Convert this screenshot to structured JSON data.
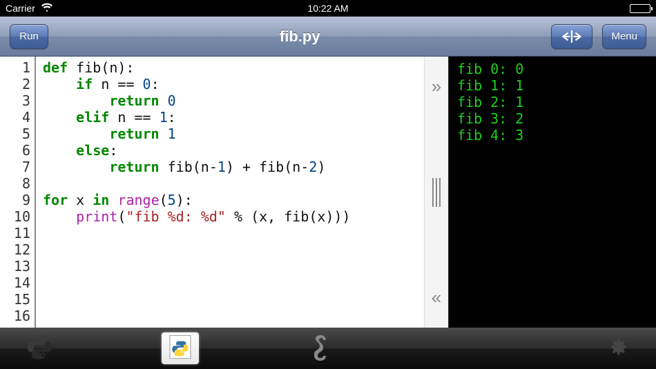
{
  "statusbar": {
    "carrier": "Carrier",
    "time": "10:22 AM"
  },
  "toolbar": {
    "run_label": "Run",
    "title": "fib.py",
    "menu_label": "Menu"
  },
  "code": {
    "line_count": 16,
    "lines": [
      [
        [
          "kw",
          "def"
        ],
        [
          "sp",
          " "
        ],
        [
          "id",
          "fib"
        ],
        [
          "op",
          "(n):"
        ]
      ],
      [
        [
          "ind",
          1
        ],
        [
          "kw",
          "if"
        ],
        [
          "sp",
          " "
        ],
        [
          "id",
          "n"
        ],
        [
          "sp",
          " "
        ],
        [
          "op",
          "=="
        ],
        [
          "sp",
          " "
        ],
        [
          "num",
          "0"
        ],
        [
          "op",
          ":"
        ]
      ],
      [
        [
          "ind",
          2
        ],
        [
          "kw",
          "return"
        ],
        [
          "sp",
          " "
        ],
        [
          "num",
          "0"
        ]
      ],
      [
        [
          "ind",
          1
        ],
        [
          "kw",
          "elif"
        ],
        [
          "sp",
          " "
        ],
        [
          "id",
          "n"
        ],
        [
          "sp",
          " "
        ],
        [
          "op",
          "=="
        ],
        [
          "sp",
          " "
        ],
        [
          "num",
          "1"
        ],
        [
          "op",
          ":"
        ]
      ],
      [
        [
          "ind",
          2
        ],
        [
          "kw",
          "return"
        ],
        [
          "sp",
          " "
        ],
        [
          "num",
          "1"
        ]
      ],
      [
        [
          "ind",
          1
        ],
        [
          "kw",
          "else"
        ],
        [
          "op",
          ":"
        ]
      ],
      [
        [
          "ind",
          2
        ],
        [
          "kw",
          "return"
        ],
        [
          "sp",
          " "
        ],
        [
          "id",
          "fib(n"
        ],
        [
          "op",
          "-"
        ],
        [
          "num",
          "1"
        ],
        [
          "id",
          ")"
        ],
        [
          "sp",
          " "
        ],
        [
          "op",
          "+"
        ],
        [
          "sp",
          " "
        ],
        [
          "id",
          "fib(n"
        ],
        [
          "op",
          "-"
        ],
        [
          "num",
          "2"
        ],
        [
          "id",
          ")"
        ]
      ],
      [],
      [
        [
          "kw",
          "for"
        ],
        [
          "sp",
          " "
        ],
        [
          "id",
          "x"
        ],
        [
          "sp",
          " "
        ],
        [
          "kw",
          "in"
        ],
        [
          "sp",
          " "
        ],
        [
          "fn",
          "range"
        ],
        [
          "op",
          "("
        ],
        [
          "num",
          "5"
        ],
        [
          "op",
          "):"
        ]
      ],
      [
        [
          "ind",
          1
        ],
        [
          "fn",
          "print"
        ],
        [
          "op",
          "("
        ],
        [
          "str",
          "\"fib %d: %d\""
        ],
        [
          "sp",
          " "
        ],
        [
          "op",
          "%"
        ],
        [
          "sp",
          " "
        ],
        [
          "op",
          "(x, fib(x)))"
        ]
      ],
      [],
      [],
      [],
      [],
      [],
      []
    ]
  },
  "console_output": [
    "fib 0: 0",
    "fib 1: 1",
    "fib 2: 1",
    "fib 3: 2",
    "fib 4: 3"
  ],
  "tabs": {
    "items": [
      "python-logo",
      "file-fib",
      "python-snake",
      "settings"
    ],
    "active_index": 1
  }
}
